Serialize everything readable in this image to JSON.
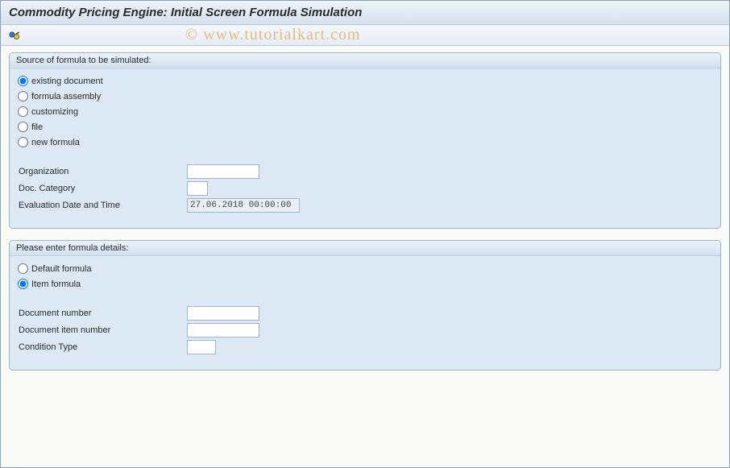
{
  "header": {
    "title": "Commodity Pricing Engine: Initial Screen Formula Simulation"
  },
  "toolbar": {
    "execute_icon": "execute"
  },
  "group1": {
    "title": "Source of formula to be simulated:",
    "radios": {
      "existing": "existing document",
      "assembly": "formula assembly",
      "customizing": "customizing",
      "file": "file",
      "newformula": "new formula"
    },
    "fields": {
      "organization_label": "Organization",
      "organization_value": "",
      "doccat_label": "Doc. Category",
      "doccat_value": "",
      "eval_label": "Evaluation Date and Time",
      "eval_value": "27.06.2018 00:00:00"
    }
  },
  "group2": {
    "title": "Please enter formula details:",
    "radios": {
      "default": "Default formula",
      "item": "Item formula"
    },
    "fields": {
      "docnum_label": "Document number",
      "docnum_value": "",
      "itemnum_label": "Document item number",
      "itemnum_value": "",
      "cond_label": "Condition Type",
      "cond_value": ""
    }
  },
  "watermark": "© www.tutorialkart.com"
}
